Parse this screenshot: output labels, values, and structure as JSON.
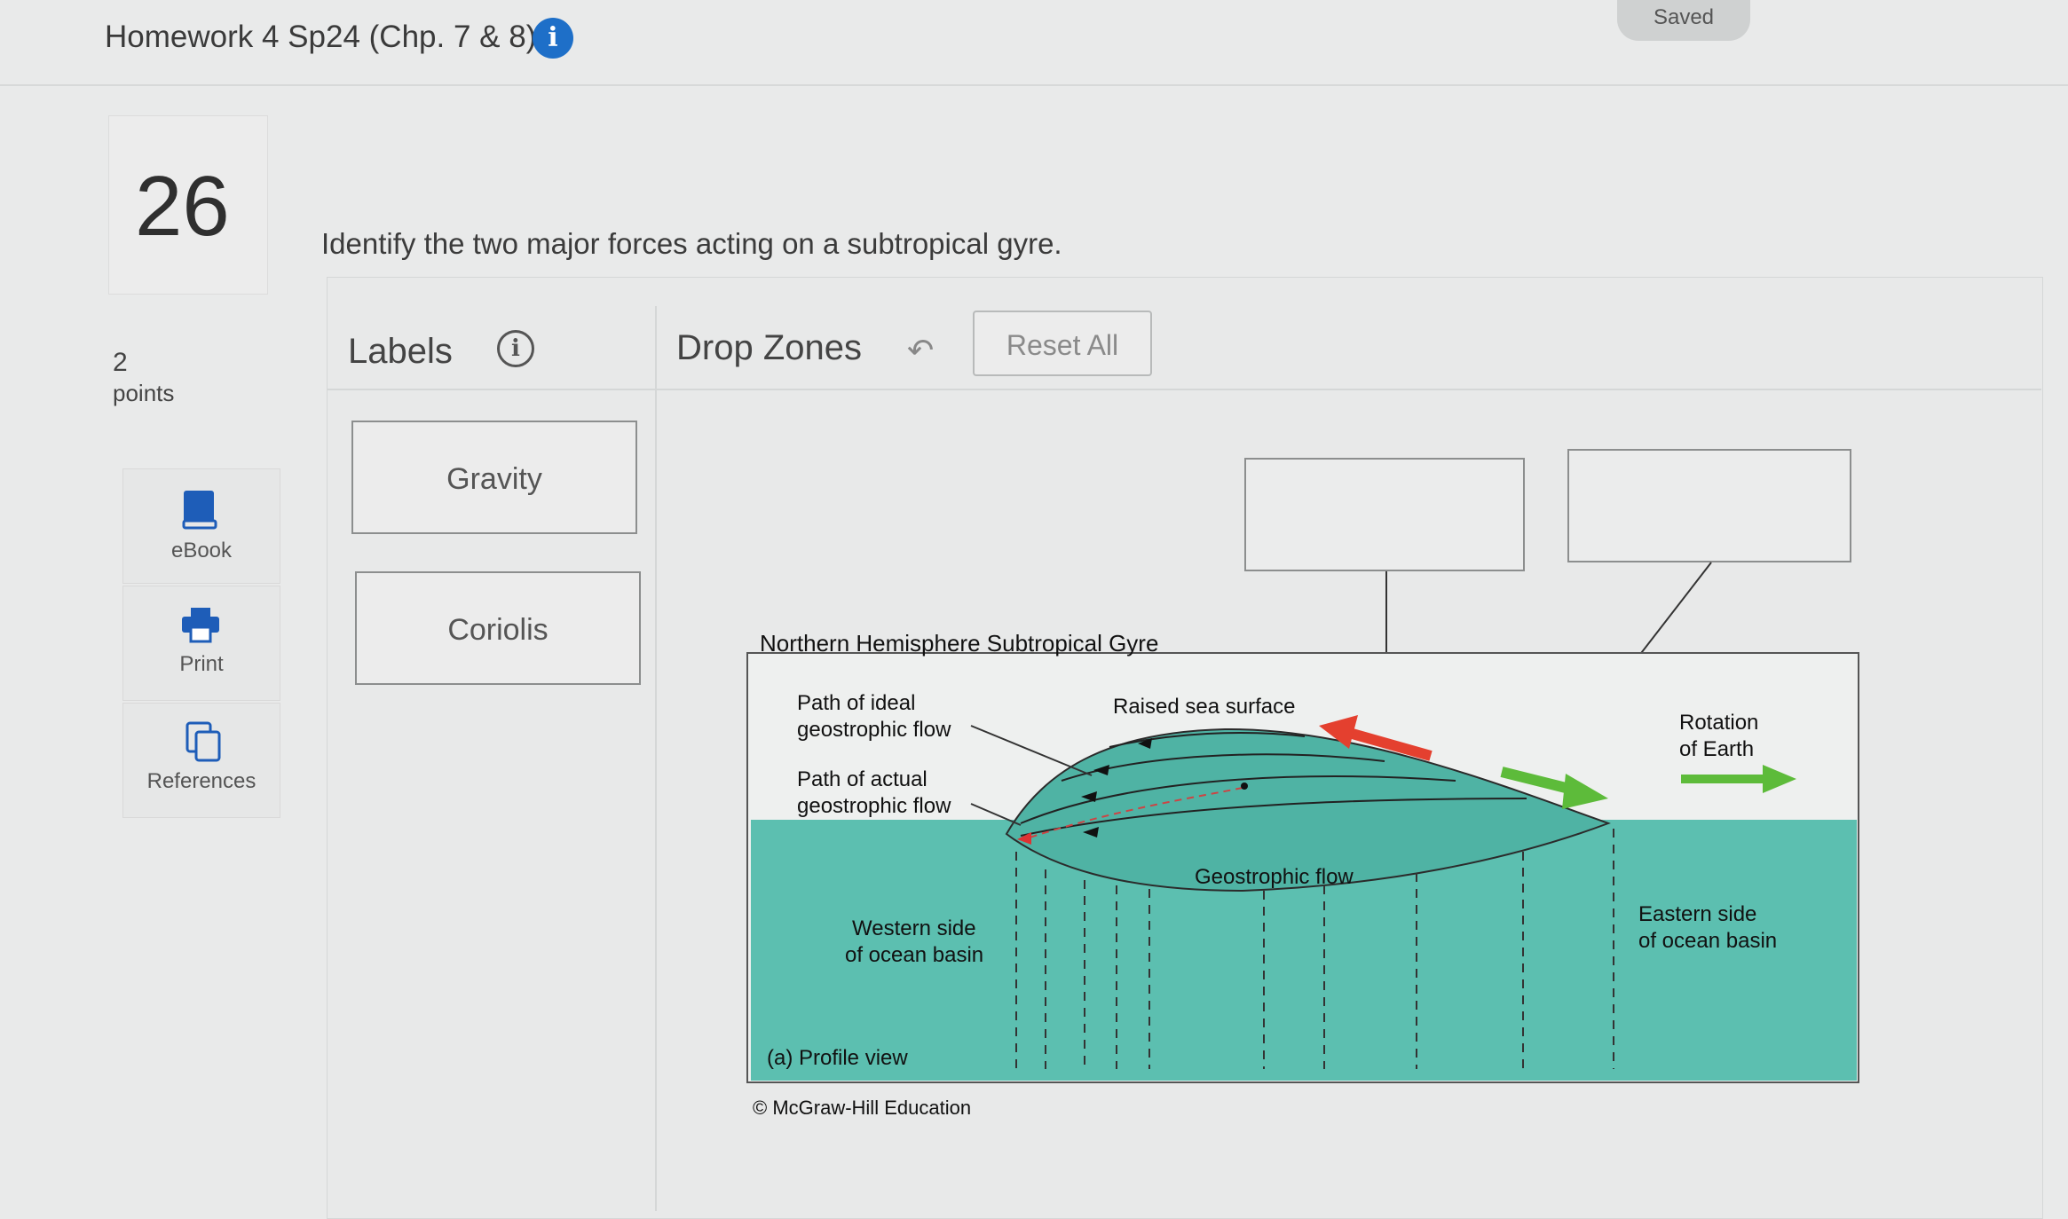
{
  "header": {
    "title": "Homework 4 Sp24 (Chp. 7 & 8)",
    "info_icon": "info-icon",
    "saved_status": "Saved"
  },
  "question": {
    "number": "26",
    "prompt": "Identify the two major forces acting on a subtropical gyre.",
    "points_value": "2",
    "points_label": "points"
  },
  "sidebar": {
    "items": [
      {
        "label": "eBook",
        "icon": "book-icon"
      },
      {
        "label": "Print",
        "icon": "printer-icon"
      },
      {
        "label": "References",
        "icon": "copy-icon"
      }
    ]
  },
  "dnd": {
    "labels_heading": "Labels",
    "dropzones_heading": "Drop Zones",
    "reset_label": "Reset All",
    "labels": [
      {
        "text": "Gravity"
      },
      {
        "text": "Coriolis"
      }
    ]
  },
  "figure": {
    "title": "Northern Hemisphere Subtropical Gyre",
    "path_ideal": [
      "Path of ideal",
      "geostrophic flow"
    ],
    "path_actual": [
      "Path of actual",
      "geostrophic flow"
    ],
    "raised_sea_surface": "Raised sea surface",
    "rotation": [
      "Rotation",
      "of Earth"
    ],
    "geostrophic_flow": "Geostrophic flow",
    "western_side": [
      "Western side",
      "of ocean basin"
    ],
    "eastern_side": [
      "Eastern side",
      "of ocean basin"
    ],
    "profile_view": "(a) Profile view",
    "credit": "© McGraw-Hill Education",
    "colors": {
      "water": "#5cbfb0",
      "mound": "#4fb3a4",
      "red_arrow": "#e4402f",
      "green_arrow": "#5dbb3a"
    }
  }
}
